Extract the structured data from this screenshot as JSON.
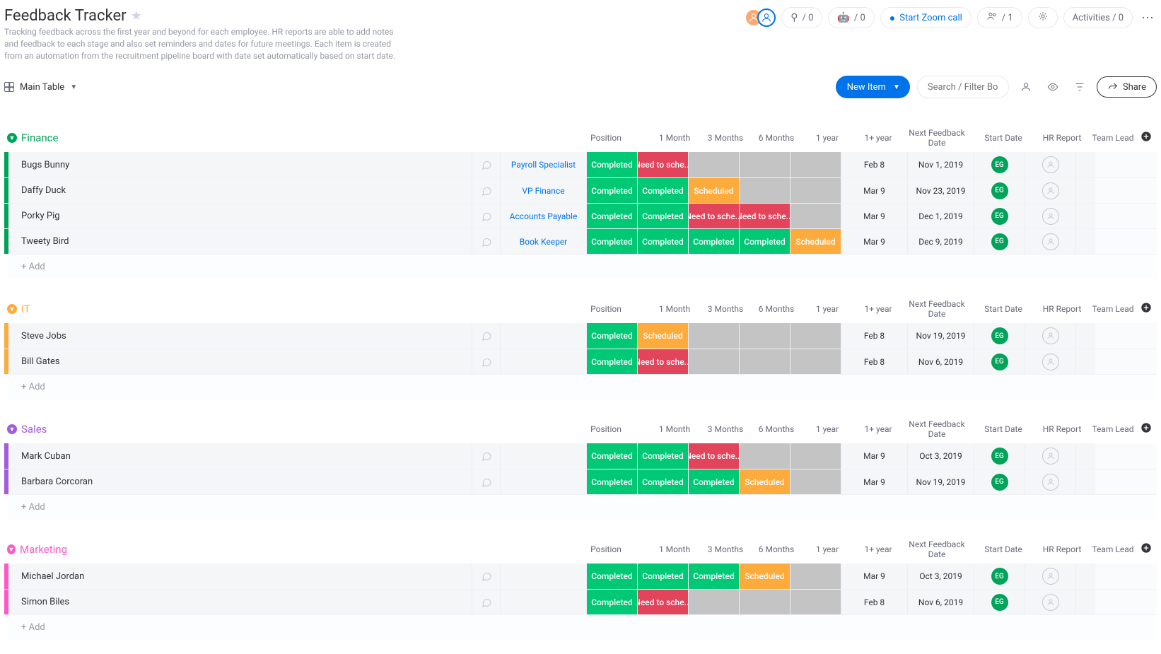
{
  "board": {
    "title": "Feedback Tracker",
    "description": "Tracking feedback across the first year and beyond for each employee. HR reports are able to add notes and feedback to each stage and also set reminders and dates for future meetings. Each item is created from an automation from the recruitment pipeline board with date set automatically based on start date."
  },
  "topbar": {
    "integration1": "/ 0",
    "integration2": "/ 0",
    "zoom": "Start Zoom call",
    "people_count": "/ 1",
    "activities": "Activities / 0"
  },
  "viewbar": {
    "view_name": "Main Table",
    "new_item": "New Item",
    "search_placeholder": "Search / Filter Board",
    "share": "Share"
  },
  "columns": [
    "Position",
    "1 Month",
    "3 Months",
    "6 Months",
    "1 year",
    "1+ year",
    "Next Feedback Date",
    "Start Date",
    "HR Report",
    "Team Lead"
  ],
  "status_colors": {
    "Completed": "#00c875",
    "Scheduled": "#fdab3d",
    "Need to sche...": "#e2445c",
    "": "#c4c4c4"
  },
  "add_row": "+ Add",
  "hr_badge": "EG",
  "groups": [
    {
      "name": "Finance",
      "color": "#00a359",
      "rows": [
        {
          "name": "Bugs Bunny",
          "position": "Payroll Specialist",
          "s": [
            "Completed",
            "Need to sche...",
            "",
            "",
            ""
          ],
          "nfd": "Feb 8",
          "start": "Nov 1, 2019",
          "hr": "EG"
        },
        {
          "name": "Daffy Duck",
          "position": "VP Finance",
          "s": [
            "Completed",
            "Completed",
            "Scheduled",
            "",
            ""
          ],
          "nfd": "Mar 9",
          "start": "Nov 23, 2019",
          "hr": "EG"
        },
        {
          "name": "Porky Pig",
          "position": "Accounts Payable",
          "s": [
            "Completed",
            "Completed",
            "Need to sche...",
            "Need to sche...",
            ""
          ],
          "nfd": "Mar 9",
          "start": "Dec 1, 2019",
          "hr": "EG"
        },
        {
          "name": "Tweety Bird",
          "position": "Book Keeper",
          "s": [
            "Completed",
            "Completed",
            "Completed",
            "Completed",
            "Scheduled"
          ],
          "nfd": "Mar 9",
          "start": "Dec 9, 2019",
          "hr": "EG"
        }
      ]
    },
    {
      "name": "IT",
      "color": "#fdab3d",
      "rows": [
        {
          "name": "Steve Jobs",
          "position": "",
          "s": [
            "Completed",
            "Scheduled",
            "",
            "",
            ""
          ],
          "nfd": "Feb 8",
          "start": "Nov 19, 2019",
          "hr": "EG"
        },
        {
          "name": "Bill Gates",
          "position": "",
          "s": [
            "Completed",
            "Need to sche...",
            "",
            "",
            ""
          ],
          "nfd": "Feb 8",
          "start": "Nov 6, 2019",
          "hr": "EG"
        }
      ]
    },
    {
      "name": "Sales",
      "color": "#a25ddc",
      "rows": [
        {
          "name": "Mark Cuban",
          "position": "",
          "s": [
            "Completed",
            "Completed",
            "Need to sche...",
            "",
            ""
          ],
          "nfd": "Mar 9",
          "start": "Oct 3, 2019",
          "hr": "EG"
        },
        {
          "name": "Barbara Corcoran",
          "position": "",
          "s": [
            "Completed",
            "Completed",
            "Completed",
            "Scheduled",
            ""
          ],
          "nfd": "Mar 9",
          "start": "Nov 19, 2019",
          "hr": "EG"
        }
      ]
    },
    {
      "name": "Marketing",
      "color": "#ff5ac4",
      "rows": [
        {
          "name": "Michael Jordan",
          "position": "",
          "s": [
            "Completed",
            "Completed",
            "Completed",
            "Scheduled",
            ""
          ],
          "nfd": "Mar 9",
          "start": "Oct 3, 2019",
          "hr": "EG"
        },
        {
          "name": "Simon Biles",
          "position": "",
          "s": [
            "Completed",
            "Need to sche...",
            "",
            "",
            ""
          ],
          "nfd": "Feb 8",
          "start": "Nov 6, 2019",
          "hr": "EG"
        }
      ]
    }
  ]
}
